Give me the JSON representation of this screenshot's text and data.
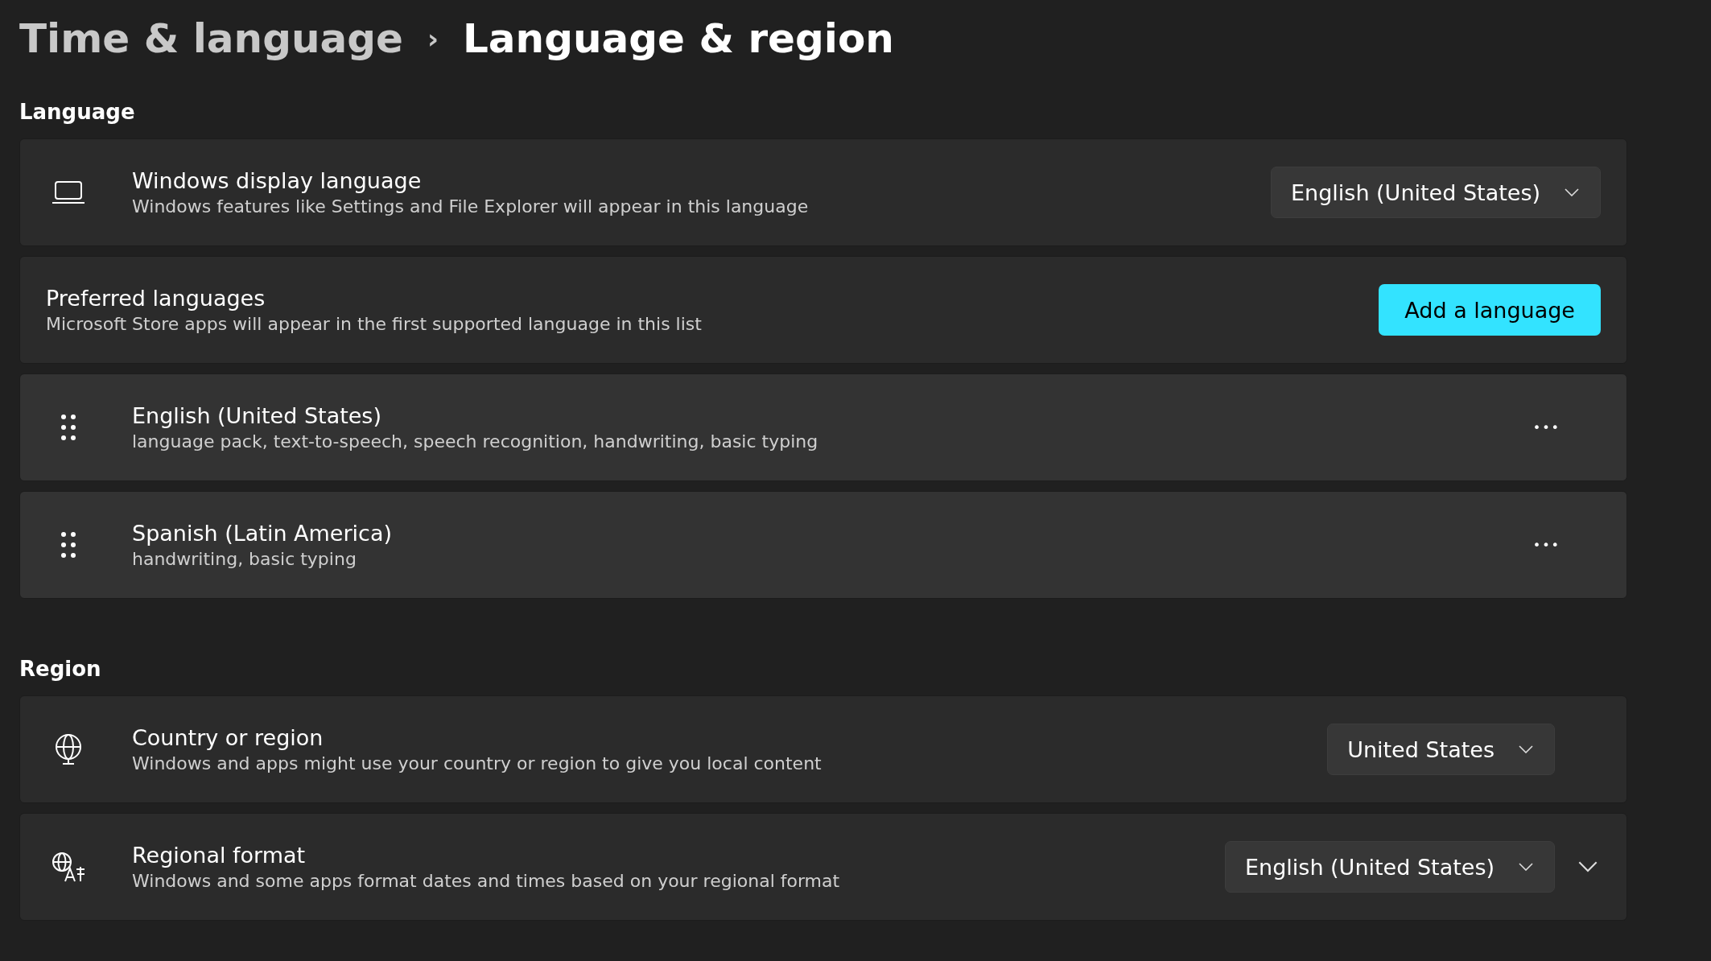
{
  "breadcrumb": {
    "parent": "Time & language",
    "separator": "›",
    "current": "Language & region"
  },
  "sections": [
    {
      "title": "Language",
      "items": [
        {
          "kind": "display",
          "title": "Windows display language",
          "description": "Windows features like Settings and File Explorer will appear in this language",
          "control": {
            "kind": "dropdown",
            "value": "English (United States)"
          }
        },
        {
          "kind": "preferences",
          "title": "Preferred languages",
          "description": "Microsoft Store apps will appear in the first supported language in this list",
          "control": {
            "kind": "button",
            "label": "Add a language"
          }
        },
        {
          "kind": "language",
          "title": "English (United States)",
          "description": "language pack, text-to-speech, speech recognition, handwriting, basic typing",
          "control": {
            "kind": "more",
            "label": "•••"
          }
        },
        {
          "kind": "language",
          "title": "Spanish (Latin America)",
          "description": "handwriting, basic typing",
          "control": {
            "kind": "more",
            "label": "•••"
          }
        }
      ]
    },
    {
      "title": "Region",
      "items": [
        {
          "kind": "country",
          "title": "Country or region",
          "description": "Windows and apps might use your country or region to give you local content",
          "control": {
            "kind": "dropdown",
            "value": "United States"
          }
        },
        {
          "kind": "format",
          "title": "Regional format",
          "description": "Windows and some apps format dates and times based on your regional format",
          "control": {
            "kind": "dropdown",
            "value": "English (United States)"
          },
          "expanded": false
        }
      ]
    }
  ]
}
